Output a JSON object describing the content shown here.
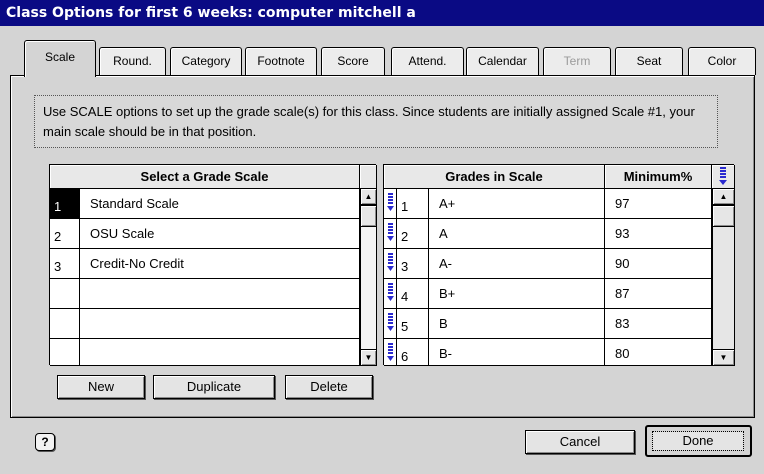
{
  "window": {
    "title": "Class Options for first 6 weeks: computer mitchell a"
  },
  "tabs": [
    {
      "label": "Scale",
      "active": true,
      "enabled": true
    },
    {
      "label": "Round.",
      "active": false,
      "enabled": true
    },
    {
      "label": "Category",
      "active": false,
      "enabled": true
    },
    {
      "label": "Footnote",
      "active": false,
      "enabled": true
    },
    {
      "label": "Score",
      "active": false,
      "enabled": true
    },
    {
      "label": "Attend.",
      "active": false,
      "enabled": true
    },
    {
      "label": "Calendar",
      "active": false,
      "enabled": true
    },
    {
      "label": "Term",
      "active": false,
      "enabled": false
    },
    {
      "label": "Seat",
      "active": false,
      "enabled": true
    },
    {
      "label": "Color",
      "active": false,
      "enabled": true
    }
  ],
  "info": {
    "text": "Use SCALE options to set up the grade scale(s) for this class. Since students are initially assigned Scale #1, your main scale should be in that position."
  },
  "scales": {
    "header": "Select a Grade Scale",
    "selected_index": 0,
    "rows": [
      {
        "num": "1",
        "name": "Standard Scale"
      },
      {
        "num": "2",
        "name": "OSU Scale"
      },
      {
        "num": "3",
        "name": "Credit-No Credit"
      },
      {
        "num": "",
        "name": ""
      },
      {
        "num": "",
        "name": ""
      },
      {
        "num": "",
        "name": ""
      }
    ]
  },
  "grades": {
    "header_grade": "Grades in Scale",
    "header_min": "Minimum%",
    "rows": [
      {
        "num": "1",
        "grade": "A+",
        "min": "97"
      },
      {
        "num": "2",
        "grade": "A",
        "min": "93"
      },
      {
        "num": "3",
        "grade": "A-",
        "min": "90"
      },
      {
        "num": "4",
        "grade": "B+",
        "min": "87"
      },
      {
        "num": "5",
        "grade": "B",
        "min": "83"
      },
      {
        "num": "6",
        "grade": "B-",
        "min": "80"
      }
    ]
  },
  "buttons": {
    "new": "New",
    "duplicate": "Duplicate",
    "delete": "Delete",
    "help": "?",
    "cancel": "Cancel",
    "done": "Done"
  },
  "colors": {
    "titlebar": "#0a0a84",
    "selection": "#000000",
    "handle": "#2a2ad0"
  },
  "icons": {
    "scroll_up": "scroll-up-arrow-icon",
    "scroll_down": "scroll-down-arrow-icon",
    "row_handle": "drag-handle-icon",
    "column_menu": "column-menu-icon"
  }
}
